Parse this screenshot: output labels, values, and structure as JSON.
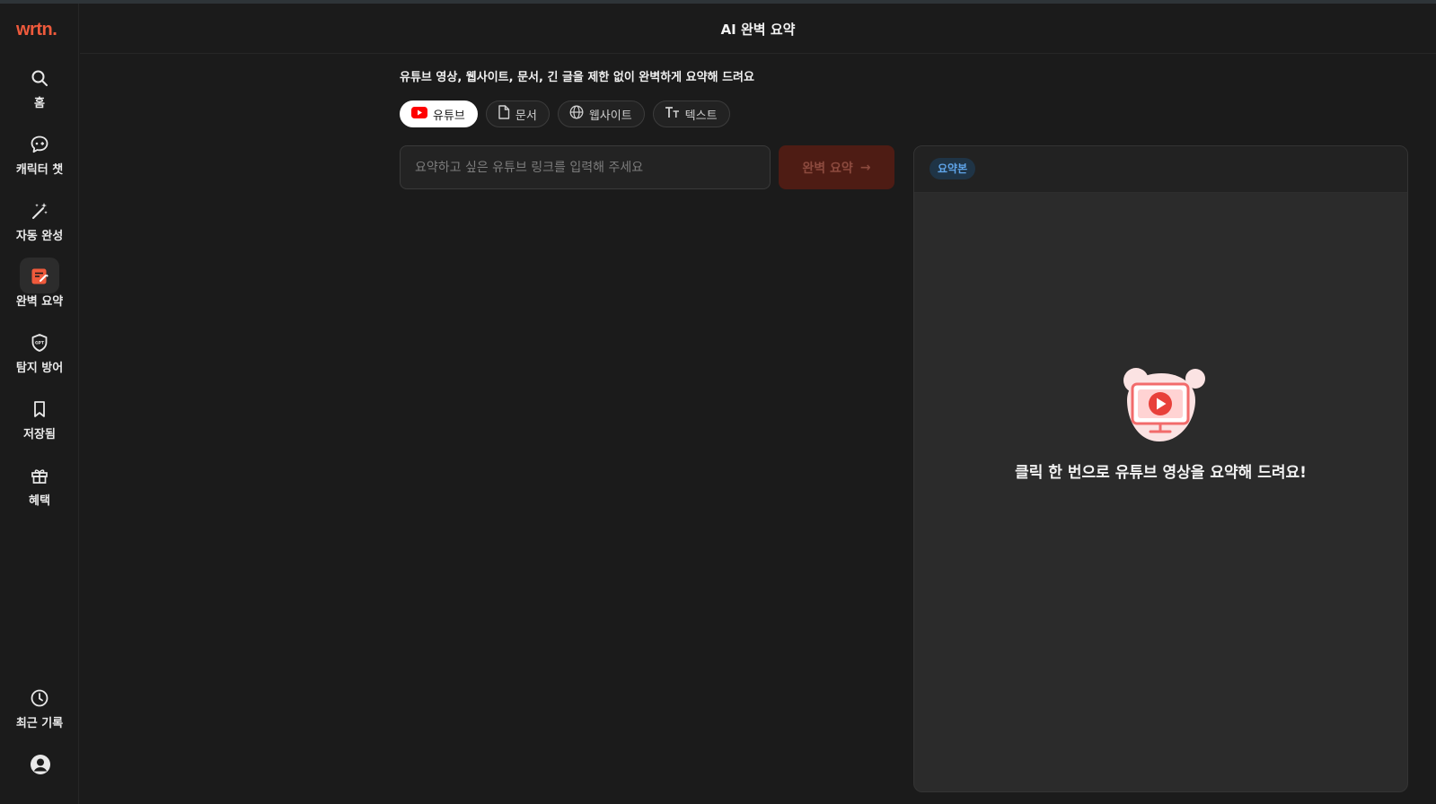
{
  "app": {
    "logo": "wrtn."
  },
  "sidebar": {
    "items": [
      {
        "label": "홈",
        "icon": "search-icon"
      },
      {
        "label": "캐릭터 챗",
        "icon": "chat-bubble-icon"
      },
      {
        "label": "자동 완성",
        "icon": "magic-wand-icon"
      },
      {
        "label": "완벽 요약",
        "icon": "summary-doc-icon",
        "active": true
      },
      {
        "label": "탐지 방어",
        "icon": "gpt-shield-icon"
      },
      {
        "label": "저장됨",
        "icon": "bookmark-icon"
      },
      {
        "label": "혜택",
        "icon": "gift-icon"
      }
    ],
    "bottom": [
      {
        "label": "최근 기록",
        "icon": "clock-icon"
      },
      {
        "label": "",
        "icon": "user-avatar-icon"
      }
    ]
  },
  "header": {
    "title": "AI 완벽 요약"
  },
  "main": {
    "subtitle": "유튜브 영상, 웹사이트, 문서, 긴 글을 제한 없이 완벽하게 요약해 드려요",
    "tabs": [
      {
        "label": "유튜브",
        "icon": "youtube-icon",
        "active": true
      },
      {
        "label": "문서",
        "icon": "document-icon"
      },
      {
        "label": "웹사이트",
        "icon": "globe-icon"
      },
      {
        "label": "텍스트",
        "icon": "text-icon"
      }
    ],
    "input": {
      "placeholder": "요약하고 싶은 유튜브 링크를 입력해 주세요",
      "value": ""
    },
    "submit_label": "완벽 요약",
    "submit_arrow": "→"
  },
  "panel": {
    "badge": "요약본",
    "empty_message": "클릭 한 번으로 유튜브 영상을 요약해 드려요!"
  },
  "colors": {
    "accent": "#ef5a3c",
    "background": "#1b1b1b",
    "badge_text": "#5fa4e8"
  }
}
